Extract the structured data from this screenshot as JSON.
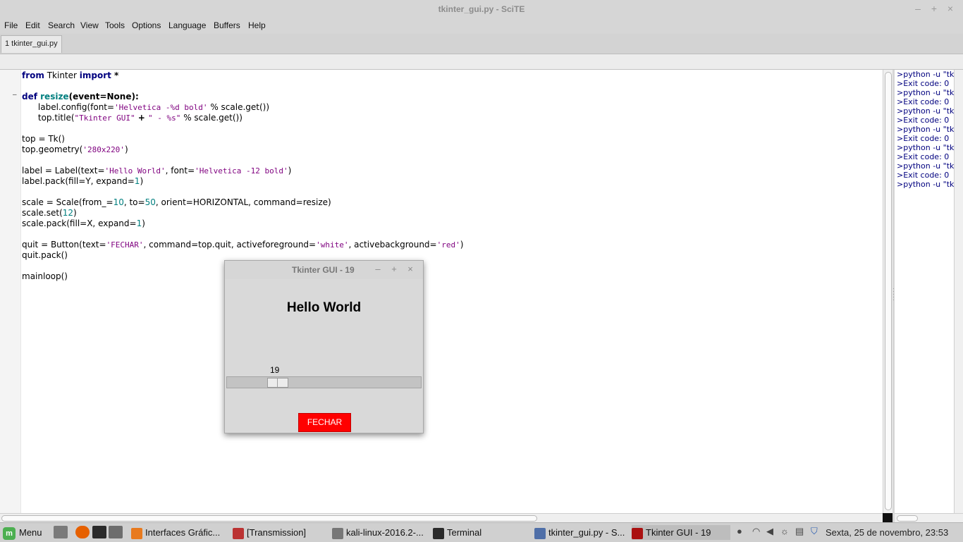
{
  "window": {
    "title": "tkinter_gui.py - SciTE",
    "controls": [
      "–",
      "+",
      "×"
    ]
  },
  "menubar": [
    "File",
    "Edit",
    "Search",
    "View",
    "Tools",
    "Options",
    "Language",
    "Buffers",
    "Help"
  ],
  "tabs": [
    {
      "label": "1 tkinter_gui.py"
    }
  ],
  "code": {
    "l1a": "from",
    "l1b": " Tkinter ",
    "l1c": "import",
    "l1d": " *",
    "l3a": "def",
    "l3b": " resize",
    "l3c": "(event=None):",
    "l4a": "      label.config(font=",
    "l4b": "'Helvetica -%d bold'",
    "l4c": " % scale.get())",
    "l5a": "      top.title(",
    "l5b": "\"Tkinter GUI\"",
    "l5c": " + ",
    "l5d": "\" - %s\"",
    "l5e": " % scale.get())",
    "l7": "top = Tk()",
    "l8a": "top.geometry(",
    "l8b": "'280x220'",
    "l8c": ")",
    "l10a": "label = Label(text=",
    "l10b": "'Hello World'",
    "l10c": ", font=",
    "l10d": "'Helvetica -12 bold'",
    "l10e": ")",
    "l11a": "label.pack(fill=Y, expand=",
    "l11b": "1",
    "l11c": ")",
    "l13a": "scale = Scale(from_=",
    "l13b": "10",
    "l13c": ", to=",
    "l13d": "50",
    "l13e": ", orient=HORIZONTAL, command=resize)",
    "l14a": "scale.set(",
    "l14b": "12",
    "l14c": ")",
    "l15a": "scale.pack(fill=X, expand=",
    "l15b": "1",
    "l15c": ")",
    "l17a": "quit = Button(text=",
    "l17b": "'FECHAR'",
    "l17c": ", command=top.quit, activeforeground=",
    "l17d": "'white'",
    "l17e": ", activebackground=",
    "l17f": "'red'",
    "l17g": ")",
    "l18": "quit.pack()",
    "l20": "mainloop()"
  },
  "output": [
    ">python -u \"tk",
    ">Exit code: 0",
    ">python -u \"tk",
    ">Exit code: 0",
    ">python -u \"tk",
    ">Exit code: 0",
    ">python -u \"tk",
    ">Exit code: 0",
    ">python -u \"tk",
    ">Exit code: 0",
    ">python -u \"tk",
    ">Exit code: 0",
    ">python -u \"tk"
  ],
  "tkinter_window": {
    "title": "Tkinter GUI - 19",
    "label": "Hello World",
    "scale_value": "19",
    "button_label": "FECHAR",
    "button_color": "#ff0000"
  },
  "taskbar": {
    "menu_label": "Menu",
    "tasks": [
      {
        "label": "Interfaces Gráfic..."
      },
      {
        "label": "[Transmission]"
      },
      {
        "label": "kali-linux-2016.2-..."
      },
      {
        "label": "Terminal"
      },
      {
        "label": "tkinter_gui.py - S..."
      },
      {
        "label": "Tkinter GUI - 19"
      }
    ],
    "clock": "Sexta, 25 de novembro, 23:53"
  }
}
